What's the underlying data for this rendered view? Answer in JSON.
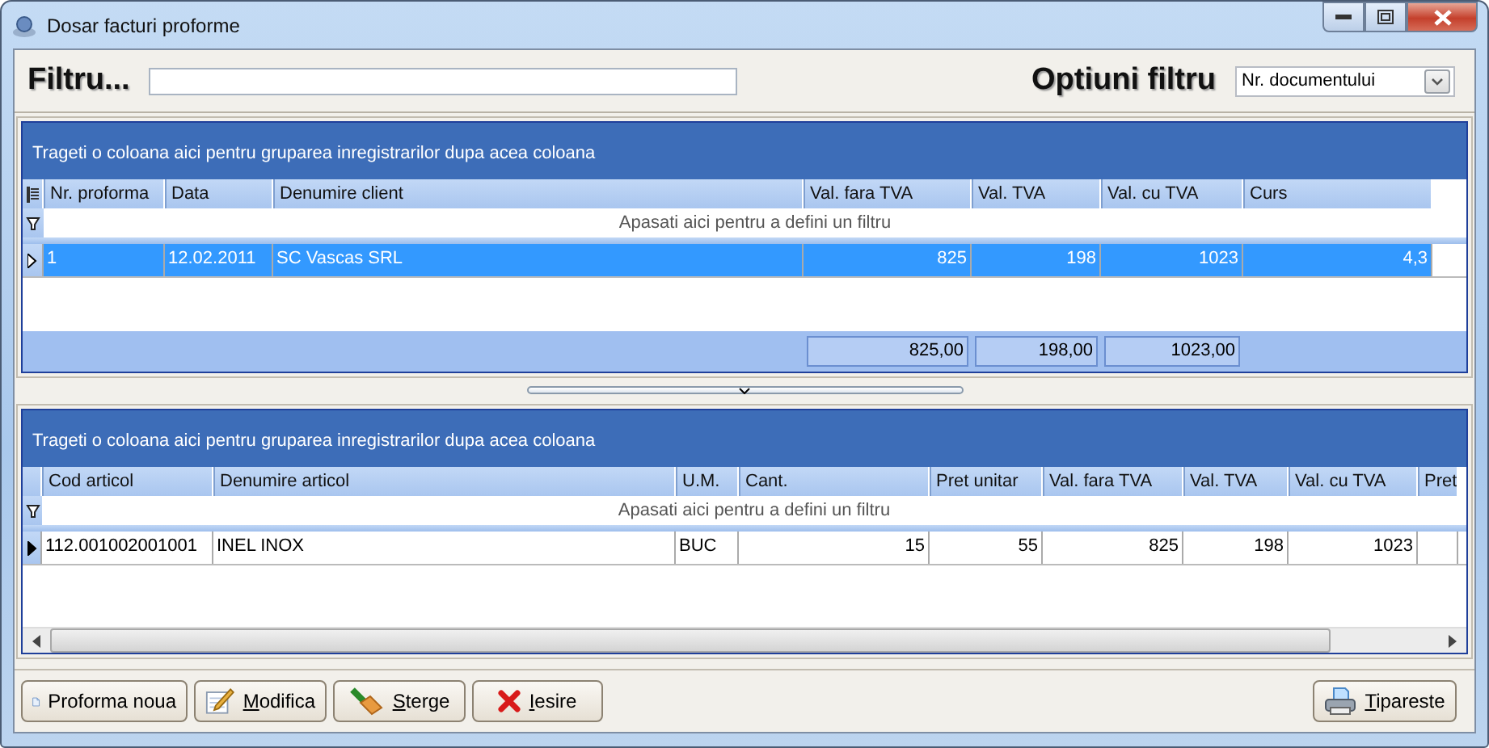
{
  "window": {
    "title": "Dosar facturi proforme"
  },
  "filter": {
    "label": "Filtru..."
  },
  "filter_options": {
    "label": "Optiuni filtru",
    "value": "Nr. documentului"
  },
  "invoices_grid": {
    "group_hint": "Trageti o coloana aici pentru gruparea inregistrarilor dupa acea coloana",
    "columns": [
      "Nr. proforma",
      "Data",
      "Denumire client",
      "Val. fara TVA",
      "Val. TVA",
      "Val. cu TVA",
      "Curs"
    ],
    "filter_hint": "Apasati aici pentru a defini un filtru",
    "rows": [
      {
        "cells": [
          "1",
          "12.02.2011",
          "SC Vascas SRL",
          "825",
          "198",
          "1023",
          "4,3"
        ],
        "selected": true,
        "current": true
      }
    ],
    "totals": [
      "825,00",
      "198,00",
      "1023,00"
    ]
  },
  "items_grid": {
    "group_hint": "Trageti o coloana aici pentru gruparea inregistrarilor dupa acea coloana",
    "columns": [
      "Cod articol",
      "Denumire articol",
      "U.M.",
      "Cant.",
      "Pret unitar",
      "Val. fara TVA",
      "Val. TVA",
      "Val. cu TVA",
      "Pret"
    ],
    "filter_hint": "Apasati aici pentru a defini un filtru",
    "rows": [
      {
        "cells": [
          "112.001002001001",
          "INEL INOX",
          "BUC",
          "15",
          "55",
          "825",
          "198",
          "1023"
        ],
        "selected": false,
        "current": true
      }
    ]
  },
  "buttons": [
    {
      "label": "Proforma noua",
      "kind": "new",
      "mnemonic": false
    },
    {
      "label": "Modifica",
      "kind": "edit",
      "mnemonic": true
    },
    {
      "label": "Sterge",
      "kind": "delete",
      "mnemonic": true
    },
    {
      "label": "Iesire",
      "kind": "exit",
      "mnemonic": true
    }
  ],
  "print_button": {
    "label": "Tipareste",
    "kind": "print",
    "mnemonic": true
  }
}
